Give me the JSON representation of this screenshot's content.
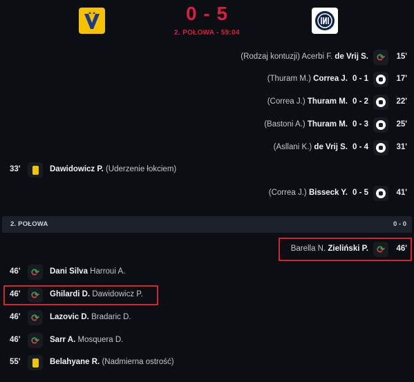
{
  "match": {
    "score": "0 - 5",
    "status": "2. POŁOWA - 59:04"
  },
  "events_first_half": [
    {
      "side": "away",
      "minute": "15'",
      "type": "substitution",
      "main": "de Vrij S.",
      "secondary": "(Rodzaj kontuzji) Acerbi F."
    },
    {
      "side": "away",
      "minute": "17'",
      "type": "goal",
      "main": "Correa J.",
      "secondary": "(Thuram M.)",
      "score": "0 - 1"
    },
    {
      "side": "away",
      "minute": "22'",
      "type": "goal",
      "main": "Thuram M.",
      "secondary": "(Correa J.)",
      "score": "0 - 2"
    },
    {
      "side": "away",
      "minute": "25'",
      "type": "goal",
      "main": "Thuram M.",
      "secondary": "(Bastoni A.)",
      "score": "0 - 3"
    },
    {
      "side": "away",
      "minute": "31'",
      "type": "goal",
      "main": "de Vrij S.",
      "secondary": "(Asllani K.)",
      "score": "0 - 4"
    },
    {
      "side": "home",
      "minute": "33'",
      "type": "yellow-card",
      "main": "Dawidowicz P.",
      "secondary": "(Uderzenie łokciem)"
    },
    {
      "side": "away",
      "minute": "41'",
      "type": "goal",
      "main": "Bisseck Y.",
      "secondary": "(Correa J.)",
      "score": "0 - 5"
    }
  ],
  "period": {
    "label": "2. POŁOWA",
    "score": "0 - 0"
  },
  "events_second_half": [
    {
      "side": "away",
      "minute": "46'",
      "type": "substitution",
      "main": "Zieliński P.",
      "secondary": "Barella N."
    },
    {
      "side": "home",
      "minute": "46'",
      "type": "substitution",
      "main": "Dani Silva",
      "secondary": "Harroui A."
    },
    {
      "side": "home",
      "minute": "46'",
      "type": "substitution",
      "main": "Ghilardi D.",
      "secondary": "Dawidowicz P."
    },
    {
      "side": "home",
      "minute": "46'",
      "type": "substitution",
      "main": "Lazovic D.",
      "secondary": "Bradaric D."
    },
    {
      "side": "home",
      "minute": "46'",
      "type": "substitution",
      "main": "Sarr A.",
      "secondary": "Mosquera D."
    },
    {
      "side": "home",
      "minute": "55'",
      "type": "yellow-card",
      "main": "Belahyane R.",
      "secondary": "(Nadmierna ostrość)"
    }
  ],
  "icons": {
    "goal": "soccer-ball-icon",
    "substitution": "substitution-arrows-icon",
    "yellow-card": "yellow-card-icon"
  },
  "colors": {
    "accent": "#d81f3d",
    "home_logo": "#f6c200",
    "yellow_card": "#f3c400",
    "sub_in": "#2ea043",
    "sub_out": "#e33b45"
  }
}
